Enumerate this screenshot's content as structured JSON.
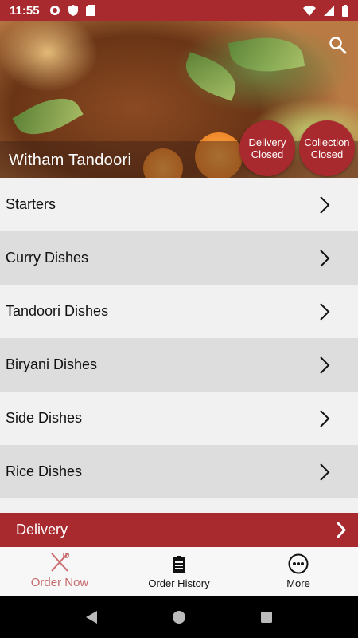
{
  "status_bar": {
    "time": "11:55"
  },
  "hero": {
    "restaurant_name": "Witham Tandoori"
  },
  "badges": {
    "delivery": {
      "line1": "Delivery",
      "line2": "Closed"
    },
    "collection": {
      "line1": "Collection",
      "line2": "Closed"
    }
  },
  "menu": {
    "items": [
      {
        "label": "Starters"
      },
      {
        "label": "Curry Dishes"
      },
      {
        "label": "Tandoori Dishes"
      },
      {
        "label": "Biryani Dishes"
      },
      {
        "label": "Side Dishes"
      },
      {
        "label": "Rice Dishes"
      }
    ]
  },
  "delivery_bar": {
    "label": "Delivery"
  },
  "bottom_nav": {
    "order_now": "Order Now",
    "order_history": "Order History",
    "more": "More"
  },
  "colors": {
    "accent": "#a82a2e",
    "active_tab": "#c96a6d"
  }
}
